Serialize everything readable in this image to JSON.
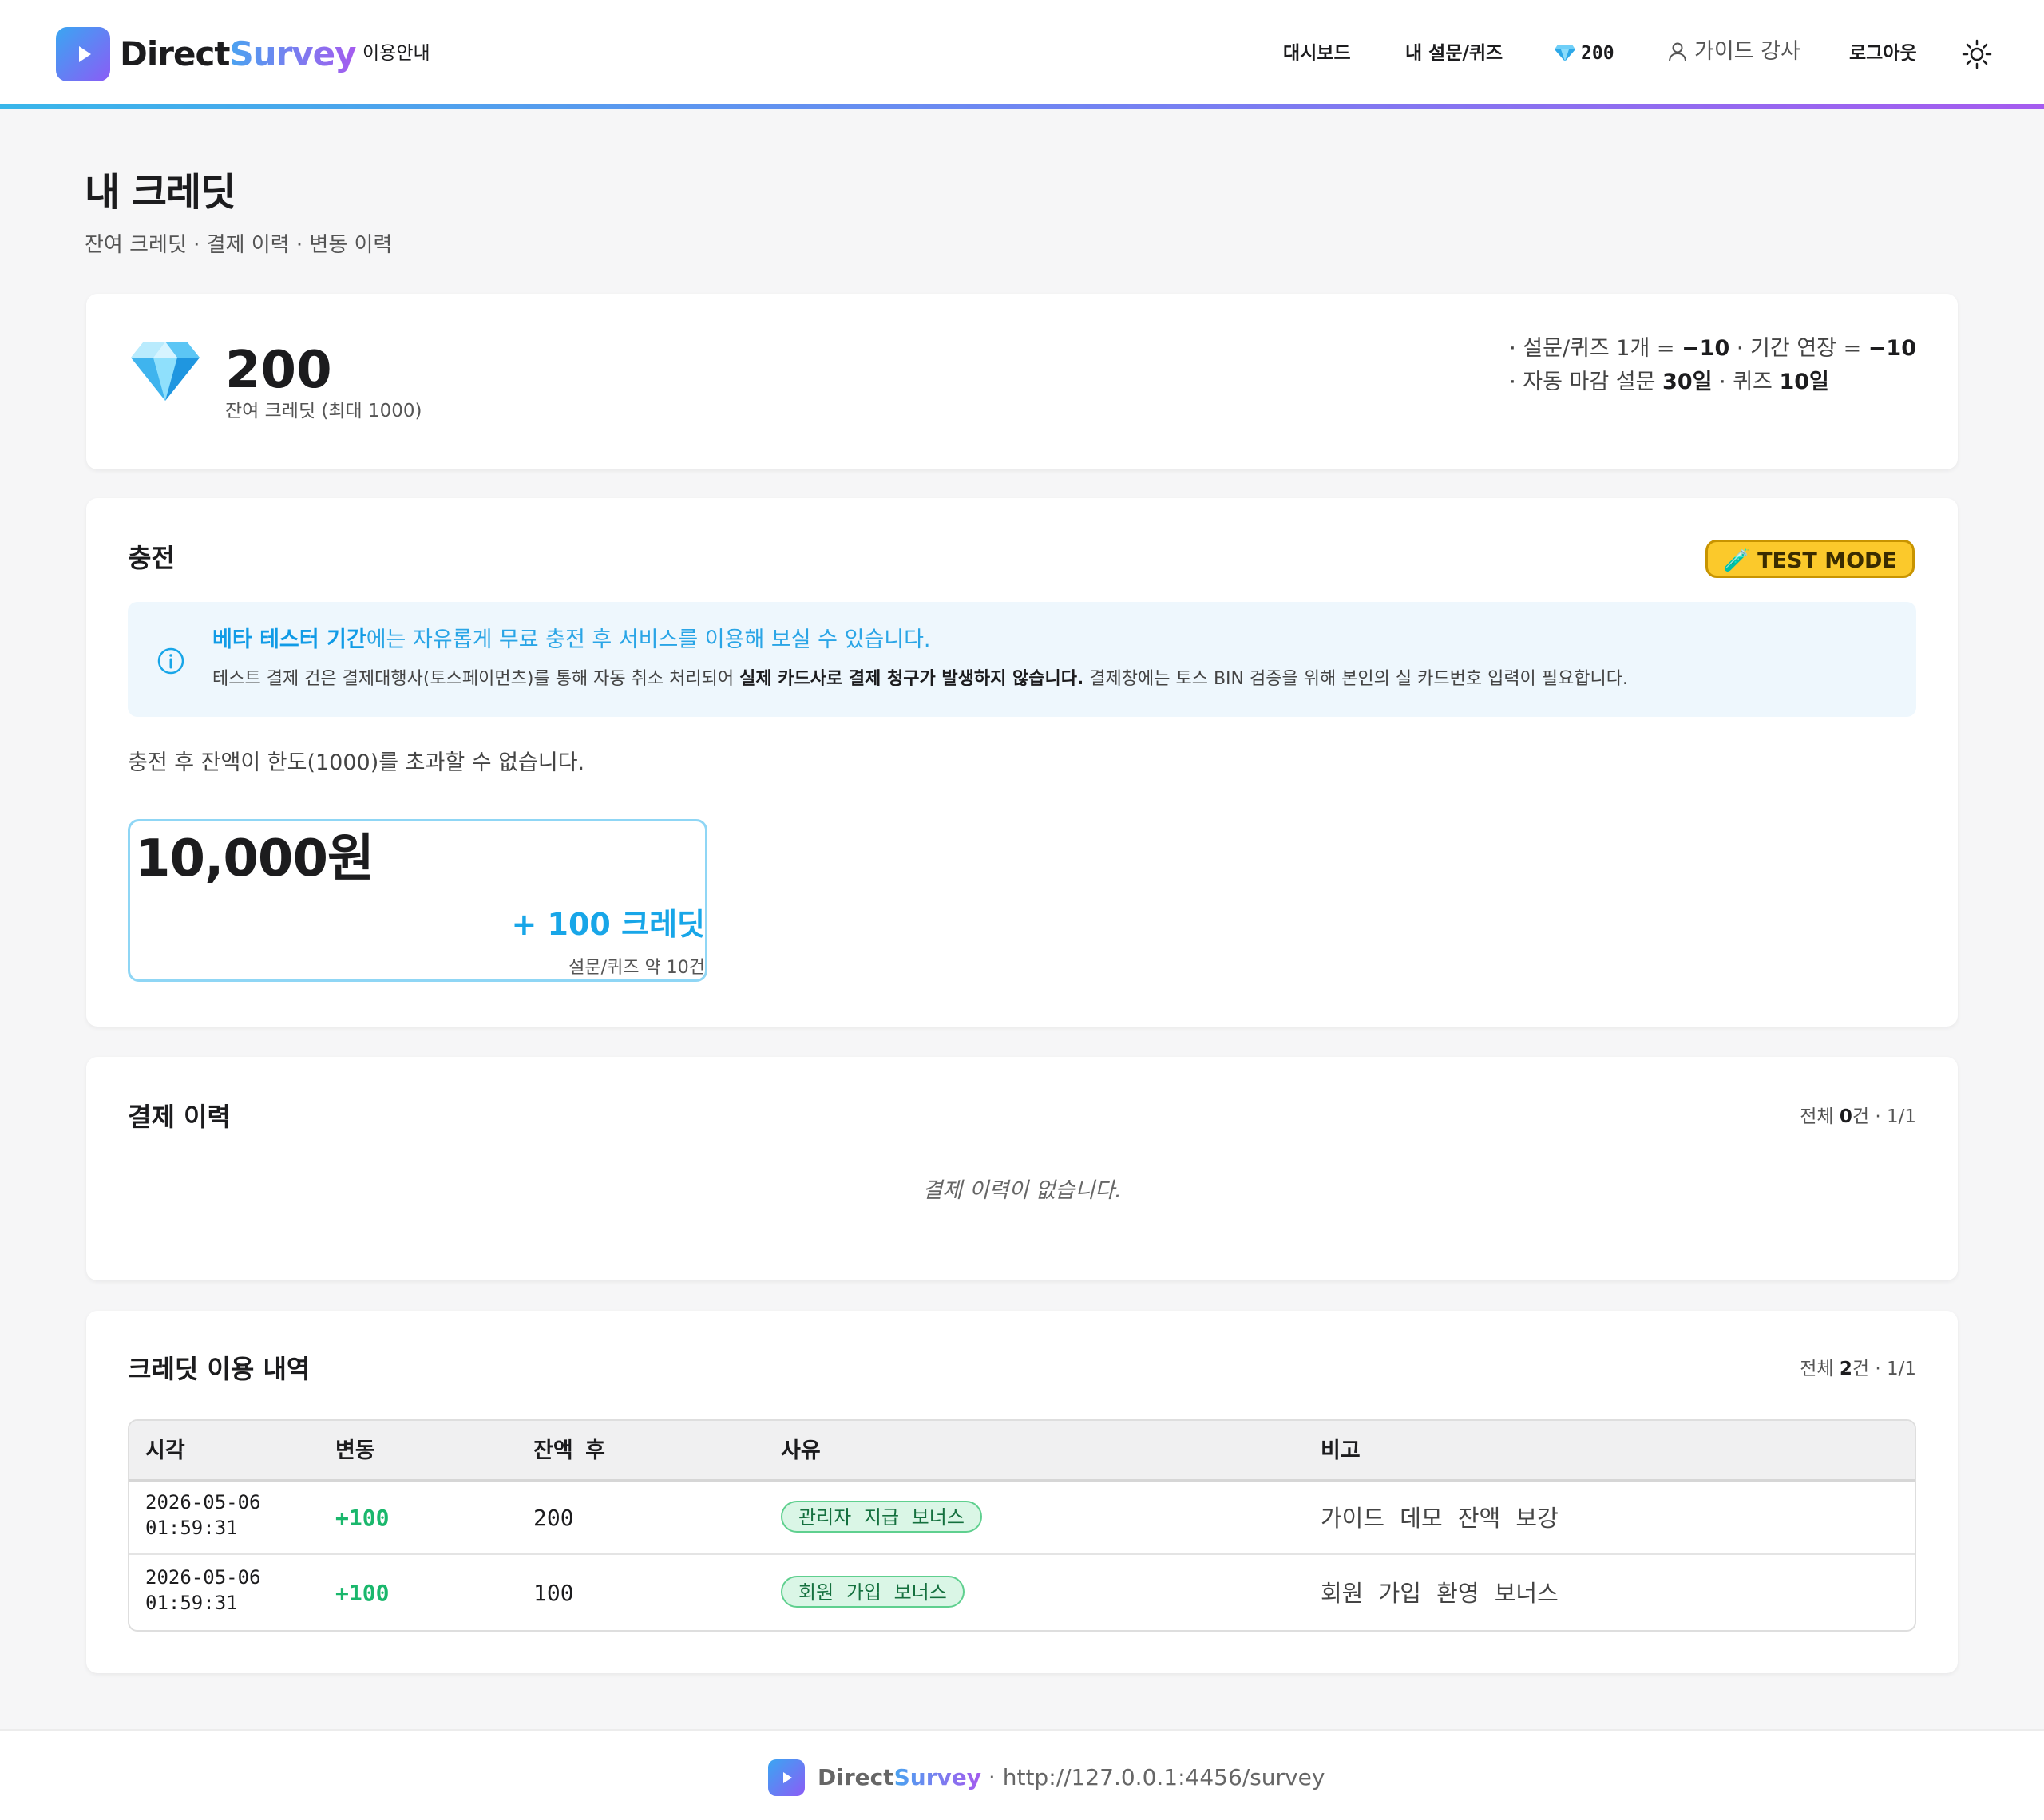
{
  "nav": {
    "brand_part1": "Direct",
    "brand_part2": "Survey",
    "guide": "이용안내",
    "dashboard": "대시보드",
    "my_surveys": "내 설문/퀴즈",
    "credit_count": "200",
    "user_name": "가이드 강사",
    "logout": "로그아웃"
  },
  "page": {
    "title": "내 크레딧",
    "subtitle": "잔여 크레딧 · 결제 이력 · 변동 이력"
  },
  "balance": {
    "value": "200",
    "label": "잔여 크레딧 (최대 1000)",
    "rule1_prefix": "· 설문/퀴즈 1개 = ",
    "rule1_cost": "−10",
    "rule1_mid": " · 기간 연장 = ",
    "rule1_cost2": "−10",
    "rule2_prefix": "· 자동 마감 설문 ",
    "rule2_survey_days": "30일",
    "rule2_mid": " · 퀴즈 ",
    "rule2_quiz_days": "10일"
  },
  "charge": {
    "heading": "충전",
    "test_badge": "🧪 TEST MODE",
    "info_line1_bold": "베타 테스터 기간",
    "info_line1_rest": "에는 자유롭게 무료 충전 후 서비스를 이용해 보실 수 있습니다.",
    "info_line2_a": "테스트 결제 건은 결제대행사(토스페이먼츠)를 통해 자동 취소 처리되어 ",
    "info_line2_bold": "실제 카드사로 결제 청구가 발생하지 않습니다.",
    "info_line2_b": " 결제창에는 토스 BIN 검증을 위해 본인의 실 카드번호 입력이 필요합니다.",
    "limit_note": "충전 후 잔액이 한도(1000)를 초과할 수 없습니다.",
    "package": {
      "price": "10,000원",
      "credit": "+ 100 크레딧",
      "count": "설문/퀴즈 약 10건"
    }
  },
  "payments": {
    "heading": "결제 이력",
    "meta_prefix": "전체 ",
    "meta_count": "0",
    "meta_suffix": "건 · 1/1",
    "empty": "결제 이력이 없습니다."
  },
  "usage": {
    "heading": "크레딧 이용 내역",
    "meta_prefix": "전체 ",
    "meta_count": "2",
    "meta_suffix": "건 · 1/1",
    "columns": [
      "시각",
      "변동",
      "잔액 후",
      "사유",
      "비고"
    ],
    "rows": [
      {
        "date": "2026-05-06",
        "time": "01:59:31",
        "change": "+100",
        "after": "200",
        "reason": "관리자 지급 보너스",
        "note": "가이드 데모 잔액 보강"
      },
      {
        "date": "2026-05-06",
        "time": "01:59:31",
        "change": "+100",
        "after": "100",
        "reason": "회원 가입 보너스",
        "note": "회원 가입 환영 보너스"
      }
    ]
  },
  "footer": {
    "brand_part1": "Direct",
    "brand_part2": "Survey",
    "url": " · http://127.0.0.1:4456/survey"
  },
  "colors": {
    "accent": "#18a6e8",
    "positive": "#1ab76c",
    "badge_yellow": "#fbc92b"
  }
}
